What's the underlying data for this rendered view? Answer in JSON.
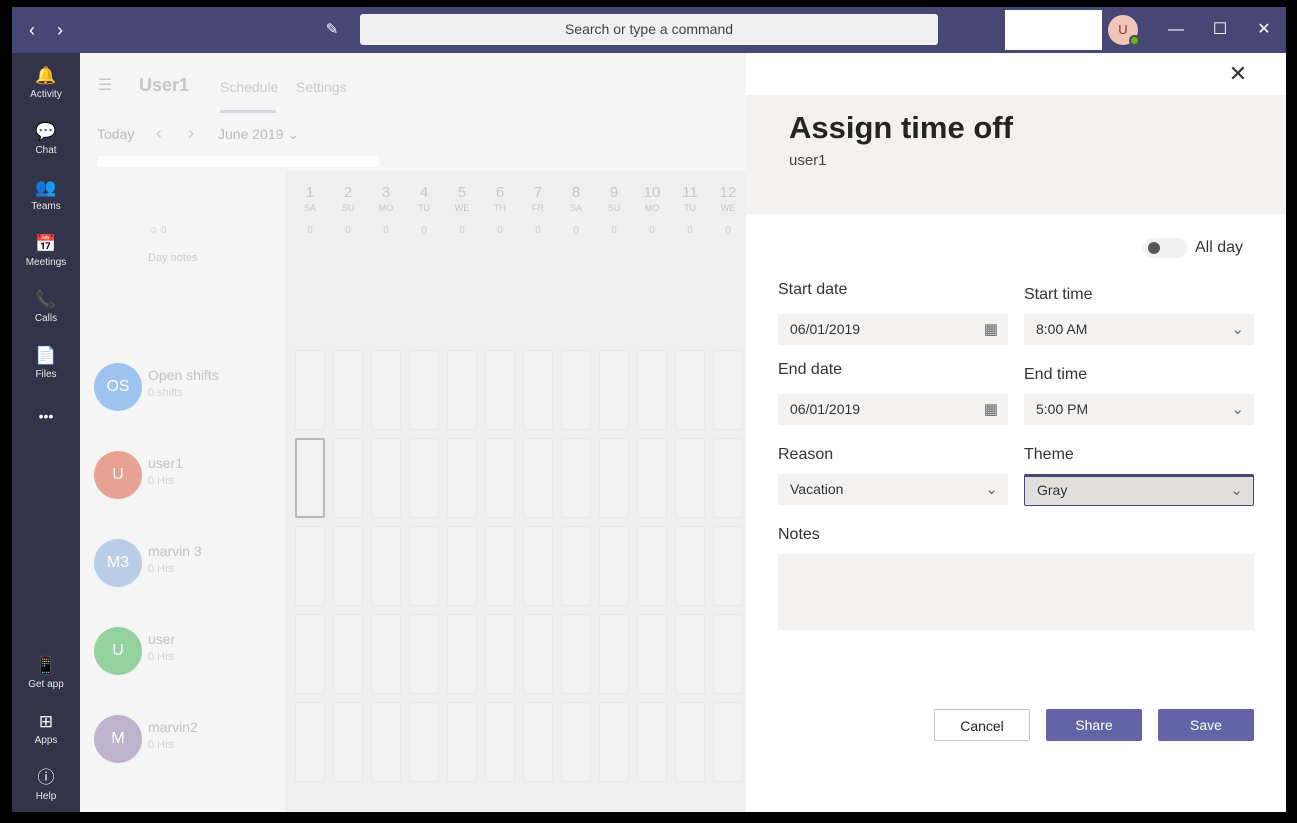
{
  "titlebar": {
    "search_placeholder": "Search or type a command",
    "avatar_initial": "U"
  },
  "rail": [
    {
      "label": "Activity",
      "icon": "bell-icon",
      "glyph": "🔔"
    },
    {
      "label": "Chat",
      "icon": "chat-icon",
      "glyph": "💬"
    },
    {
      "label": "Teams",
      "icon": "teams-icon",
      "glyph": "👥"
    },
    {
      "label": "Meetings",
      "icon": "calendar-icon",
      "glyph": "📅"
    },
    {
      "label": "Calls",
      "icon": "phone-icon",
      "glyph": "📞"
    },
    {
      "label": "Files",
      "icon": "file-icon",
      "glyph": "📄"
    },
    {
      "label": "",
      "icon": "more-icon",
      "glyph": "•••"
    },
    {
      "label": "Get app",
      "icon": "mobile-icon",
      "glyph": "📱"
    },
    {
      "label": "Apps",
      "icon": "apps-icon",
      "glyph": "⊞"
    },
    {
      "label": "Help",
      "icon": "help-icon",
      "glyph": "?"
    }
  ],
  "background": {
    "team_name": "User1",
    "tabs": [
      "Schedule",
      "Settings"
    ],
    "today": "Today",
    "month": "June 2019",
    "days": [
      {
        "n": "1",
        "w": "SA"
      },
      {
        "n": "2",
        "w": "SU"
      },
      {
        "n": "3",
        "w": "MO"
      },
      {
        "n": "4",
        "w": "TU"
      },
      {
        "n": "5",
        "w": "WE"
      },
      {
        "n": "6",
        "w": "TH"
      },
      {
        "n": "7",
        "w": "FR"
      },
      {
        "n": "8",
        "w": "SA"
      },
      {
        "n": "9",
        "w": "SU"
      },
      {
        "n": "10",
        "w": "MO"
      },
      {
        "n": "11",
        "w": "TU"
      },
      {
        "n": "12",
        "w": "WE"
      }
    ],
    "count_label": "0",
    "day_notes": "Day notes",
    "people": [
      {
        "initials": "OS",
        "name": "Open shifts",
        "sub": "0 shifts",
        "color": "#9dc3f0"
      },
      {
        "initials": "U",
        "name": "user1",
        "sub": "0 Hrs",
        "color": "#e8a294"
      },
      {
        "initials": "M3",
        "name": "marvin 3",
        "sub": "0 Hrs",
        "color": "#b9cde9"
      },
      {
        "initials": "U",
        "name": "user",
        "sub": "0 Hrs",
        "color": "#93d19e"
      },
      {
        "initials": "M",
        "name": "marvin2",
        "sub": "0 Hrs",
        "color": "#bdb3cf"
      }
    ]
  },
  "panel": {
    "title": "Assign time off",
    "subtitle": "user1",
    "all_day_label": "All day",
    "start_date_label": "Start date",
    "start_date": "06/01/2019",
    "start_time_label": "Start time",
    "start_time": "8:00 AM",
    "end_date_label": "End date",
    "end_date": "06/01/2019",
    "end_time_label": "End time",
    "end_time": "5:00 PM",
    "reason_label": "Reason",
    "reason": "Vacation",
    "theme_label": "Theme",
    "theme": "Gray",
    "notes_label": "Notes",
    "cancel": "Cancel",
    "share": "Share",
    "save": "Save"
  }
}
